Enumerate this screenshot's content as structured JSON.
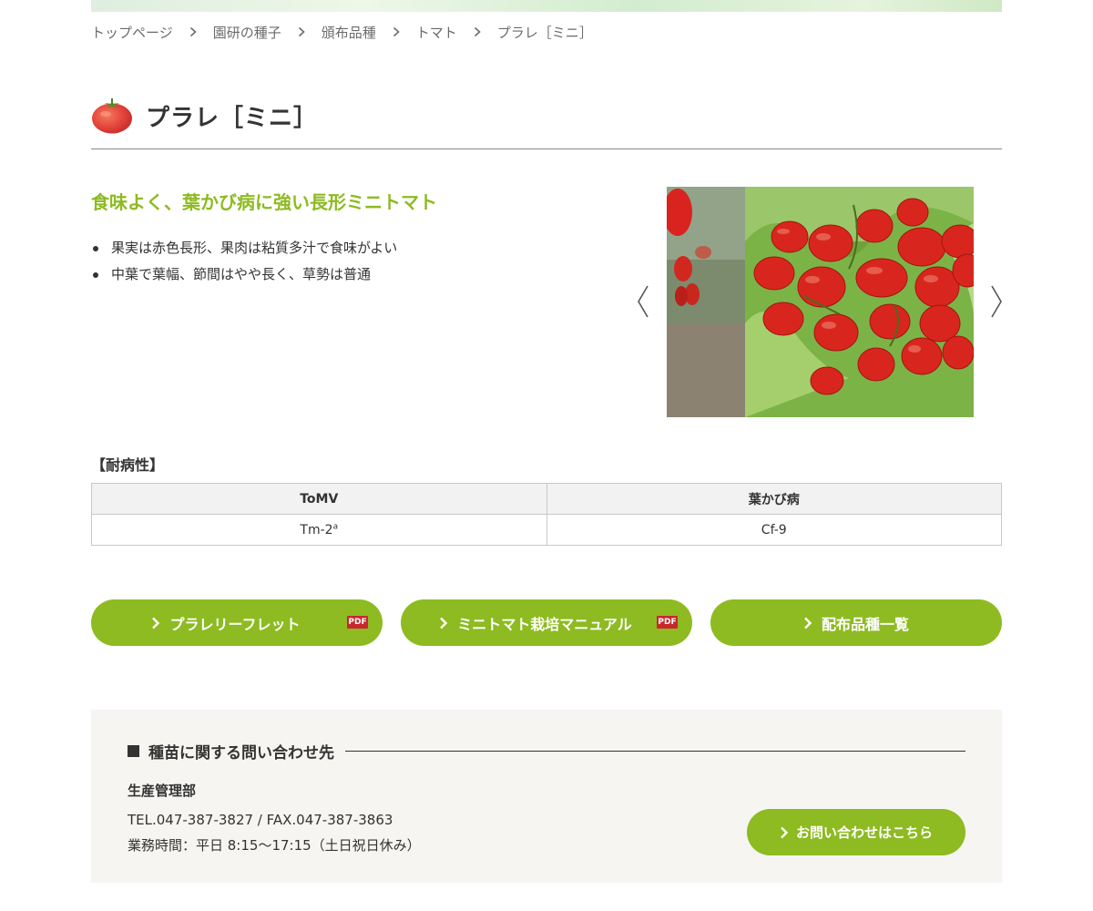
{
  "breadcrumb": {
    "items": [
      "トップページ",
      "園研の種子",
      "頒布品種",
      "トマト",
      "プラレ［ミニ］"
    ]
  },
  "page": {
    "title": "プラレ［ミニ］",
    "icon": "tomato-icon"
  },
  "product": {
    "catch": "食味よく、葉かび病に強い長形ミニトマト",
    "features": [
      "果実は赤色長形、果肉は粘質多汁で食味がよい",
      "中葉で葉幅、節間はやや長く、草勢は普通"
    ]
  },
  "resistance": {
    "heading": "【耐病性】",
    "headers": [
      "ToMV",
      "葉かび病"
    ],
    "row": [
      {
        "text": "Tm-2",
        "sup": "a"
      },
      {
        "text": "Cf-9",
        "sup": ""
      }
    ]
  },
  "buttons": [
    {
      "label": "プラレリーフレット",
      "badge": "PDF"
    },
    {
      "label": "ミニトマト栽培マニュアル",
      "badge": "PDF"
    },
    {
      "label": "配布品種一覧",
      "badge": ""
    }
  ],
  "contact": {
    "heading": "種苗に関する問い合わせ先",
    "department": "生産管理部",
    "tel": "TEL.047-387-3827 / FAX.047-387-3863",
    "hours": "業務時間：平日 8:15〜17:15（土日祝日休み）",
    "button": "お問い合わせはこちら"
  },
  "colors": {
    "accent": "#8dbb21",
    "pdf_badge": "#c8282d",
    "contact_bg": "#f6f5f1"
  }
}
